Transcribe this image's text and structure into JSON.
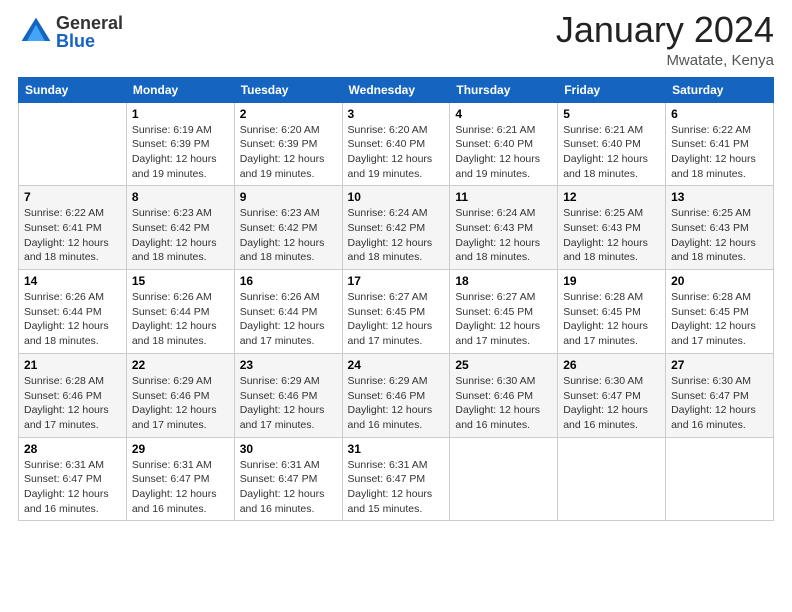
{
  "header": {
    "logo_general": "General",
    "logo_blue": "Blue",
    "month_title": "January 2024",
    "location": "Mwatate, Kenya"
  },
  "days_of_week": [
    "Sunday",
    "Monday",
    "Tuesday",
    "Wednesday",
    "Thursday",
    "Friday",
    "Saturday"
  ],
  "weeks": [
    [
      {
        "day": "",
        "info": ""
      },
      {
        "day": "1",
        "info": "Sunrise: 6:19 AM\nSunset: 6:39 PM\nDaylight: 12 hours\nand 19 minutes."
      },
      {
        "day": "2",
        "info": "Sunrise: 6:20 AM\nSunset: 6:39 PM\nDaylight: 12 hours\nand 19 minutes."
      },
      {
        "day": "3",
        "info": "Sunrise: 6:20 AM\nSunset: 6:40 PM\nDaylight: 12 hours\nand 19 minutes."
      },
      {
        "day": "4",
        "info": "Sunrise: 6:21 AM\nSunset: 6:40 PM\nDaylight: 12 hours\nand 19 minutes."
      },
      {
        "day": "5",
        "info": "Sunrise: 6:21 AM\nSunset: 6:40 PM\nDaylight: 12 hours\nand 18 minutes."
      },
      {
        "day": "6",
        "info": "Sunrise: 6:22 AM\nSunset: 6:41 PM\nDaylight: 12 hours\nand 18 minutes."
      }
    ],
    [
      {
        "day": "7",
        "info": "Sunrise: 6:22 AM\nSunset: 6:41 PM\nDaylight: 12 hours\nand 18 minutes."
      },
      {
        "day": "8",
        "info": "Sunrise: 6:23 AM\nSunset: 6:42 PM\nDaylight: 12 hours\nand 18 minutes."
      },
      {
        "day": "9",
        "info": "Sunrise: 6:23 AM\nSunset: 6:42 PM\nDaylight: 12 hours\nand 18 minutes."
      },
      {
        "day": "10",
        "info": "Sunrise: 6:24 AM\nSunset: 6:42 PM\nDaylight: 12 hours\nand 18 minutes."
      },
      {
        "day": "11",
        "info": "Sunrise: 6:24 AM\nSunset: 6:43 PM\nDaylight: 12 hours\nand 18 minutes."
      },
      {
        "day": "12",
        "info": "Sunrise: 6:25 AM\nSunset: 6:43 PM\nDaylight: 12 hours\nand 18 minutes."
      },
      {
        "day": "13",
        "info": "Sunrise: 6:25 AM\nSunset: 6:43 PM\nDaylight: 12 hours\nand 18 minutes."
      }
    ],
    [
      {
        "day": "14",
        "info": "Sunrise: 6:26 AM\nSunset: 6:44 PM\nDaylight: 12 hours\nand 18 minutes."
      },
      {
        "day": "15",
        "info": "Sunrise: 6:26 AM\nSunset: 6:44 PM\nDaylight: 12 hours\nand 18 minutes."
      },
      {
        "day": "16",
        "info": "Sunrise: 6:26 AM\nSunset: 6:44 PM\nDaylight: 12 hours\nand 17 minutes."
      },
      {
        "day": "17",
        "info": "Sunrise: 6:27 AM\nSunset: 6:45 PM\nDaylight: 12 hours\nand 17 minutes."
      },
      {
        "day": "18",
        "info": "Sunrise: 6:27 AM\nSunset: 6:45 PM\nDaylight: 12 hours\nand 17 minutes."
      },
      {
        "day": "19",
        "info": "Sunrise: 6:28 AM\nSunset: 6:45 PM\nDaylight: 12 hours\nand 17 minutes."
      },
      {
        "day": "20",
        "info": "Sunrise: 6:28 AM\nSunset: 6:45 PM\nDaylight: 12 hours\nand 17 minutes."
      }
    ],
    [
      {
        "day": "21",
        "info": "Sunrise: 6:28 AM\nSunset: 6:46 PM\nDaylight: 12 hours\nand 17 minutes."
      },
      {
        "day": "22",
        "info": "Sunrise: 6:29 AM\nSunset: 6:46 PM\nDaylight: 12 hours\nand 17 minutes."
      },
      {
        "day": "23",
        "info": "Sunrise: 6:29 AM\nSunset: 6:46 PM\nDaylight: 12 hours\nand 17 minutes."
      },
      {
        "day": "24",
        "info": "Sunrise: 6:29 AM\nSunset: 6:46 PM\nDaylight: 12 hours\nand 16 minutes."
      },
      {
        "day": "25",
        "info": "Sunrise: 6:30 AM\nSunset: 6:46 PM\nDaylight: 12 hours\nand 16 minutes."
      },
      {
        "day": "26",
        "info": "Sunrise: 6:30 AM\nSunset: 6:47 PM\nDaylight: 12 hours\nand 16 minutes."
      },
      {
        "day": "27",
        "info": "Sunrise: 6:30 AM\nSunset: 6:47 PM\nDaylight: 12 hours\nand 16 minutes."
      }
    ],
    [
      {
        "day": "28",
        "info": "Sunrise: 6:31 AM\nSunset: 6:47 PM\nDaylight: 12 hours\nand 16 minutes."
      },
      {
        "day": "29",
        "info": "Sunrise: 6:31 AM\nSunset: 6:47 PM\nDaylight: 12 hours\nand 16 minutes."
      },
      {
        "day": "30",
        "info": "Sunrise: 6:31 AM\nSunset: 6:47 PM\nDaylight: 12 hours\nand 16 minutes."
      },
      {
        "day": "31",
        "info": "Sunrise: 6:31 AM\nSunset: 6:47 PM\nDaylight: 12 hours\nand 15 minutes."
      },
      {
        "day": "",
        "info": ""
      },
      {
        "day": "",
        "info": ""
      },
      {
        "day": "",
        "info": ""
      }
    ]
  ]
}
